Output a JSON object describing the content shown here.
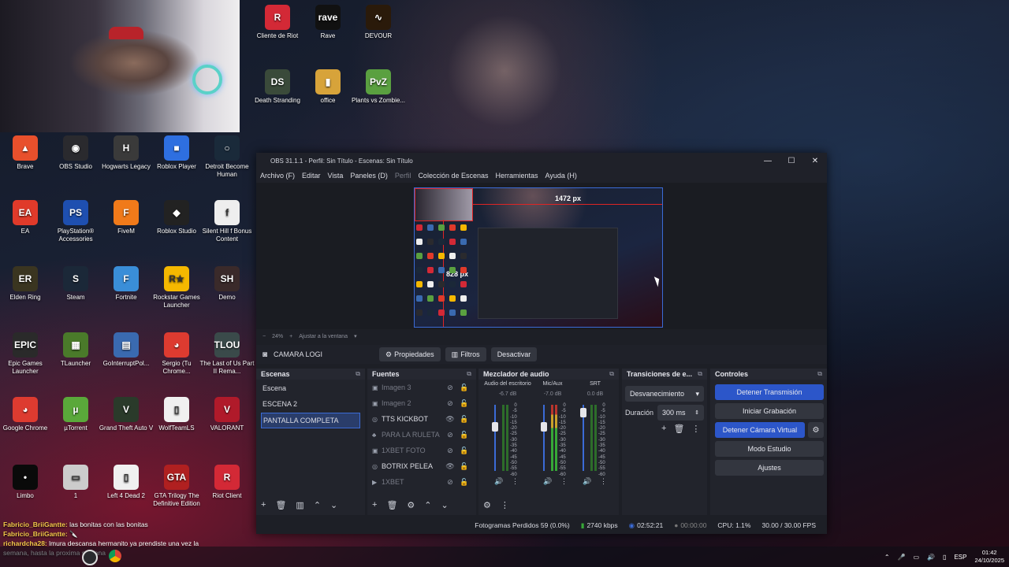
{
  "desktop": {
    "icons": [
      {
        "label": "Cliente de Riot",
        "glyph": "R",
        "color": "#d32936"
      },
      {
        "label": "Rave",
        "glyph": "rave",
        "color": "#111111"
      },
      {
        "label": "DEVOUR",
        "glyph": "∿",
        "color": "#2a1a0a"
      },
      {
        "label": "Death Stranding",
        "glyph": "DS",
        "color": "#3a4a3a"
      },
      {
        "label": "office",
        "glyph": "▮",
        "color": "#d7a33a"
      },
      {
        "label": "Plants vs Zombie...",
        "glyph": "PvZ",
        "color": "#5aa040"
      },
      {
        "label": "Brave",
        "glyph": "▲",
        "color": "#e8502c"
      },
      {
        "label": "OBS Studio",
        "glyph": "◉",
        "color": "#2a2a2e"
      },
      {
        "label": "Hogwarts Legacy",
        "glyph": "H",
        "color": "#3a3a3a"
      },
      {
        "label": "Roblox Player",
        "glyph": "■",
        "color": "#2e6fe0"
      },
      {
        "label": "Detroit Become Human",
        "glyph": "○",
        "color": "#1a2a3a"
      },
      {
        "label": "EA",
        "glyph": "EA",
        "color": "#e03a2a"
      },
      {
        "label": "PlayStation® Accessories",
        "glyph": "PS",
        "color": "#1e4fb0"
      },
      {
        "label": "FiveM",
        "glyph": "F",
        "color": "#f07a1a"
      },
      {
        "label": "Roblox Studio",
        "glyph": "◆",
        "color": "#222222"
      },
      {
        "label": "Silent Hill f Bonus Content",
        "glyph": "f",
        "color": "#eeeeee"
      },
      {
        "label": "Elden Ring",
        "glyph": "ER",
        "color": "#3a3520"
      },
      {
        "label": "Steam",
        "glyph": "S",
        "color": "#1b2838"
      },
      {
        "label": "Fortnite",
        "glyph": "F",
        "color": "#3a8ed8"
      },
      {
        "label": "Rockstar Games Launcher",
        "glyph": "R★",
        "color": "#f5b800"
      },
      {
        "label": "Demo",
        "glyph": "SH",
        "color": "#3a2a2a"
      },
      {
        "label": "Epic Games Launcher",
        "glyph": "EPIC",
        "color": "#2a2a2a"
      },
      {
        "label": "TLauncher",
        "glyph": "▦",
        "color": "#4a7a2a"
      },
      {
        "label": "GoInterruptPol...",
        "glyph": "▤",
        "color": "#3a6ab0"
      },
      {
        "label": "Sergio (Tu Chrome...",
        "glyph": "◕",
        "color": "#dd3b30"
      },
      {
        "label": "The Last of Us Part II Rema...",
        "glyph": "TLOU",
        "color": "#3a4a4a"
      },
      {
        "label": "Google Chrome",
        "glyph": "◕",
        "color": "#dd3b30"
      },
      {
        "label": "µTorrent",
        "glyph": "µ",
        "color": "#5aa83a"
      },
      {
        "label": "Grand Theft Auto V",
        "glyph": "V",
        "color": "#2a3a2a"
      },
      {
        "label": "WolfTeamLS",
        "glyph": "▯",
        "color": "#f0f0f0"
      },
      {
        "label": "VALORANT",
        "glyph": "V",
        "color": "#b01a2a"
      },
      {
        "label": "Limbo",
        "glyph": "•",
        "color": "#0a0a0a"
      },
      {
        "label": "1",
        "glyph": "▭",
        "color": "#cccccc"
      },
      {
        "label": "Left 4 Dead 2",
        "glyph": "▯",
        "color": "#f0f0f0"
      },
      {
        "label": "GTA Trilogy The Definitive Edition",
        "glyph": "GTA",
        "color": "#b02020"
      },
      {
        "label": "Riot Client",
        "glyph": "R",
        "color": "#d32936"
      }
    ]
  },
  "obs": {
    "title": "OBS 31.1.1 - Perfil: Sin Título - Escenas: Sin Título",
    "window_buttons": [
      "—",
      "☐",
      "✕"
    ],
    "menu": [
      "Archivo (F)",
      "Editar",
      "Vista",
      "Paneles (D)",
      "Perfil",
      "Colección de Escenas",
      "Herramientas",
      "Ayuda (H)"
    ],
    "preview": {
      "width_label": "1472 px",
      "height_label": "828 px"
    },
    "zoom": {
      "minus": "−",
      "value": "24%",
      "plus": "+",
      "fit": "Ajustar a la ventana",
      "arrow": "▾"
    },
    "source_bar": {
      "name": "CAMARA LOGI",
      "props": "Propiedades",
      "filters": "Filtros",
      "deactivate": "Desactivar"
    },
    "scenes": {
      "title": "Escenas",
      "items": [
        "Escena",
        "ESCENA 2",
        "PANTALLA COMPLETA"
      ],
      "selected": 2
    },
    "sources": {
      "title": "Fuentes",
      "items": [
        {
          "name": "Imagen 3",
          "icon": "▣",
          "visible": false
        },
        {
          "name": "Imagen 2",
          "icon": "▣",
          "visible": false
        },
        {
          "name": "TTS KICKBOT",
          "icon": "◎",
          "visible": true
        },
        {
          "name": "PARA LA RULETA",
          "icon": "♣",
          "visible": false
        },
        {
          "name": "1XBET FOTO",
          "icon": "▣",
          "visible": false
        },
        {
          "name": "BOTRIX PELEA",
          "icon": "◎",
          "visible": true
        },
        {
          "name": "1XBET",
          "icon": "▶",
          "visible": false
        }
      ]
    },
    "mixer": {
      "title": "Mezclador de audio",
      "channels": [
        {
          "name": "Audio del escritorio",
          "db": "-6.7 dB"
        },
        {
          "name": "Mic/Aux",
          "db": "-7.0 dB"
        },
        {
          "name": "SRT",
          "db": "0.0 dB"
        }
      ],
      "scale": [
        "0",
        "-5",
        "-10",
        "-15",
        "-20",
        "-25",
        "-30",
        "-35",
        "-40",
        "-45",
        "-50",
        "-55",
        "-60"
      ]
    },
    "transitions": {
      "title": "Transiciones de e...",
      "type": "Desvanecimiento",
      "duration_label": "Duración",
      "duration": "300 ms"
    },
    "controls": {
      "title": "Controles",
      "buttons": [
        {
          "label": "Detener Transmisión",
          "active": true
        },
        {
          "label": "Iniciar Grabación",
          "active": false
        },
        {
          "label": "Detener Cámara Virtual",
          "active": true
        },
        {
          "label": "Modo Estudio",
          "active": false
        },
        {
          "label": "Ajustes",
          "active": false
        }
      ]
    },
    "status": {
      "dropped": "Fotogramas Perdidos 59 (0.0%)",
      "bitrate": "2740 kbps",
      "stream_time": "02:52:21",
      "rec_time": "00:00:00",
      "cpu": "CPU: 1.1%",
      "fps": "30.00 / 30.00 FPS"
    }
  },
  "chat": [
    {
      "user": "Fabricio_BriiGantte:",
      "text": "las bonitas con las bonitas"
    },
    {
      "user": "Fabricio_BriiGantte:",
      "text": "🔪"
    },
    {
      "user": "richardcha28:",
      "text": "lmura descansa hermanito ya prendiste una vez la semana, hasta la proxima semana"
    }
  ],
  "taskbar": {
    "lang": "ESP",
    "time": "01:42",
    "date": "24/10/2025"
  }
}
